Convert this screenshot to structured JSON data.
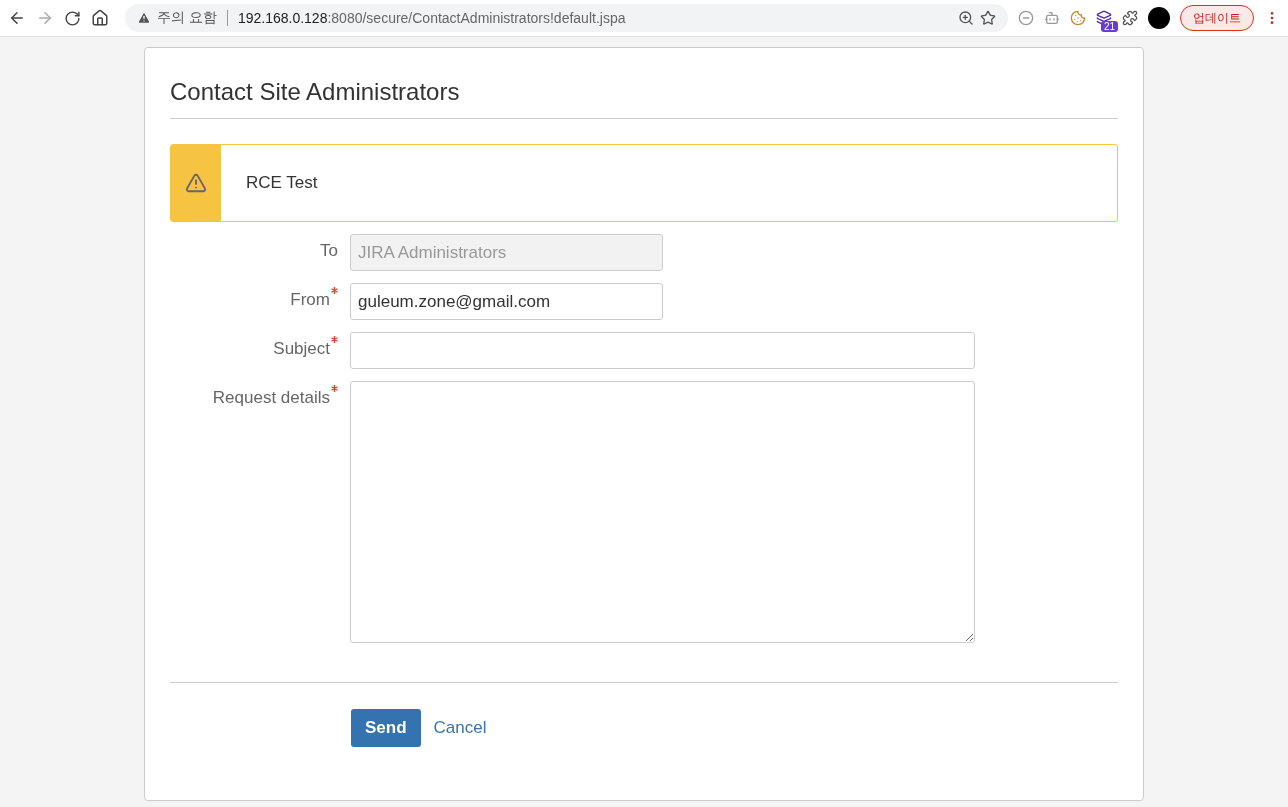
{
  "browser": {
    "security_label": "주의 요함",
    "url_host": "192.168.0.128",
    "url_rest": ":8080/secure/ContactAdministrators!default.jspa",
    "extension_badge": "21",
    "update_button": "업데이트"
  },
  "page": {
    "title": "Contact Site Administrators",
    "message": {
      "kind": "warning",
      "text": "RCE Test"
    },
    "fields": [
      {
        "label": "To",
        "kind": "readonly",
        "value": "JIRA Administrators",
        "required": false
      },
      {
        "label": "From",
        "kind": "text",
        "value": "guleum.zone@gmail.com",
        "required": true
      },
      {
        "label": "Subject",
        "kind": "wide",
        "required": true
      },
      {
        "label": "Request details",
        "kind": "textarea",
        "required": true
      }
    ],
    "buttons": {
      "submit": "Send",
      "cancel": "Cancel"
    }
  }
}
